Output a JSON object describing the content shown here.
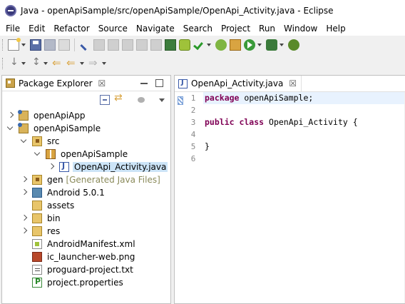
{
  "window": {
    "title": "Java - openApiSample/src/openApiSample/OpenApi_Activity.java - Eclipse"
  },
  "menu": [
    "File",
    "Edit",
    "Refactor",
    "Source",
    "Navigate",
    "Search",
    "Project",
    "Run",
    "Window",
    "Help"
  ],
  "toolbar": {
    "row1_icons": [
      "new-icon",
      "save-icon",
      "save-all-icon",
      "print-icon",
      "pin-icon",
      "toggle-breakpoint-icon",
      "toggle-mark-icon",
      "toggle-word-icon",
      "show-whitespace-icon",
      "block-select-icon",
      "android-sdk-manager-icon",
      "android-avd-icon",
      "lint-check-icon",
      "new-android-project-icon",
      "new-package-icon",
      "run-icon",
      "debug-icon",
      "bug-icon"
    ],
    "row2_icons": [
      "next-annotation-icon",
      "prev-annotation-icon",
      "last-edit-icon",
      "back-icon",
      "forward-icon"
    ]
  },
  "package_explorer": {
    "tab_label": "Package Explorer",
    "close_glyph": "☒",
    "tree": [
      {
        "label": "openApiApp",
        "icon": "project-icon",
        "level": 0,
        "twisty": "closed"
      },
      {
        "label": "openApiSample",
        "icon": "project-icon",
        "level": 0,
        "twisty": "open"
      },
      {
        "label": "src",
        "icon": "source-folder-icon",
        "level": 1,
        "twisty": "open"
      },
      {
        "label": "openApiSample",
        "icon": "package-icon",
        "level": 2,
        "twisty": "open"
      },
      {
        "label": "OpenApi_Activity.java",
        "icon": "java-file-icon",
        "level": 3,
        "twisty": "closed",
        "selected": true
      },
      {
        "label": "gen",
        "decoration": "[Generated Java Files]",
        "icon": "source-folder-icon",
        "level": 1,
        "twisty": "closed"
      },
      {
        "label": "Android 5.0.1",
        "icon": "library-icon",
        "level": 1,
        "twisty": "closed"
      },
      {
        "label": "assets",
        "icon": "folder-icon",
        "level": 1,
        "twisty": "none"
      },
      {
        "label": "bin",
        "icon": "folder-icon",
        "level": 1,
        "twisty": "closed"
      },
      {
        "label": "res",
        "icon": "folder-icon",
        "level": 1,
        "twisty": "closed"
      },
      {
        "label": "AndroidManifest.xml",
        "icon": "xml-file-icon",
        "level": 1,
        "twisty": "none"
      },
      {
        "label": "ic_launcher-web.png",
        "icon": "image-file-icon",
        "level": 1,
        "twisty": "none"
      },
      {
        "label": "proguard-project.txt",
        "icon": "text-file-icon",
        "level": 1,
        "twisty": "none"
      },
      {
        "label": "project.properties",
        "icon": "properties-file-icon",
        "level": 1,
        "twisty": "none"
      }
    ]
  },
  "editor": {
    "tab_label": "OpenApi_Activity.java",
    "close_glyph": "☒",
    "lines": [
      {
        "num": "1",
        "kw": "package",
        "rest": " openApiSample;"
      },
      {
        "num": "2",
        "kw": "",
        "rest": ""
      },
      {
        "num": "3",
        "kw": "public class",
        "rest": " OpenApi_Activity {"
      },
      {
        "num": "4",
        "kw": "",
        "rest": ""
      },
      {
        "num": "5",
        "kw": "",
        "rest": "}"
      },
      {
        "num": "6",
        "kw": "",
        "rest": ""
      }
    ]
  }
}
